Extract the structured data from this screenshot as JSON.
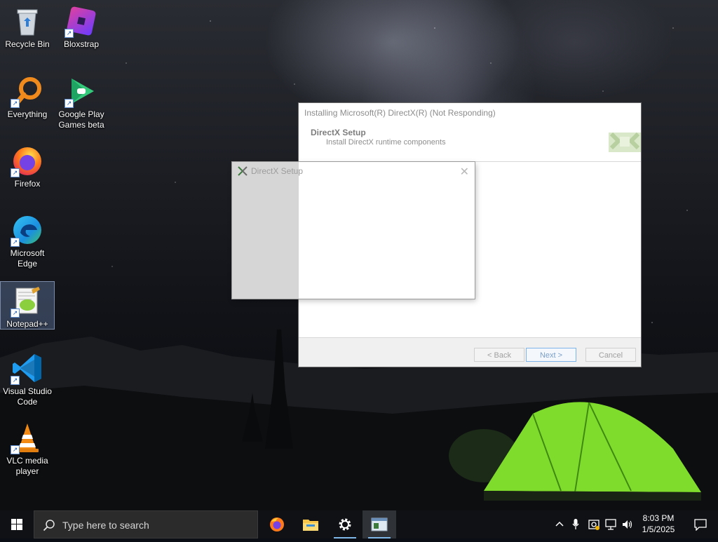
{
  "desktop": {
    "icons": [
      {
        "label": "Recycle Bin"
      },
      {
        "label": "Bloxstrap"
      },
      {
        "label": "Everything"
      },
      {
        "label": "Google Play Games beta"
      },
      {
        "label": "Firefox"
      },
      {
        "label": "Microsoft Edge"
      },
      {
        "label": "Notepad++"
      },
      {
        "label": "Visual Studio Code"
      },
      {
        "label": "VLC media player"
      }
    ]
  },
  "directx_main": {
    "title": "Installing Microsoft(R) DirectX(R) (Not Responding)",
    "header_title": "DirectX Setup",
    "header_subtitle": "Install DirectX runtime components",
    "back_label": "< Back",
    "next_label": "Next >",
    "cancel_label": "Cancel"
  },
  "directx_child": {
    "title": "DirectX Setup",
    "close_glyph": "✕"
  },
  "taskbar": {
    "search_placeholder": "Type here to search",
    "apps": [
      "firefox-icon",
      "file-explorer-icon",
      "settings-icon",
      "directx-setup-icon"
    ],
    "tray_chevron": "^",
    "time": "8:03 PM",
    "date": "1/5/2025"
  },
  "colors": {
    "taskbar": "#101114",
    "accent_underline": "#7fb6e8",
    "tent_green": "#7fdc2c"
  }
}
